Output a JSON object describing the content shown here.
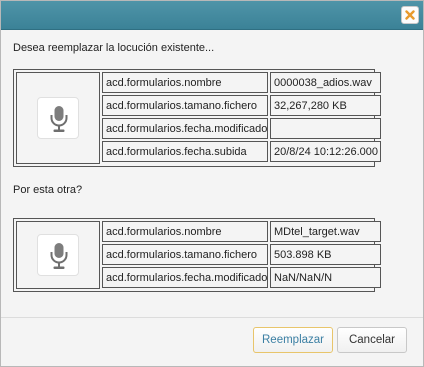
{
  "dialog": {
    "close_icon": "close-x-icon",
    "prompt_existing": "Desea reemplazar la locución existente...",
    "prompt_new": "Por esta otra?",
    "existing": {
      "icon": "microphone-icon",
      "rows": [
        {
          "key": "acd.formularios.nombre",
          "value": "0000038_adios.wav"
        },
        {
          "key": "acd.formularios.tamano.fichero",
          "value": "32,267,280 KB"
        },
        {
          "key": "acd.formularios.fecha.modificado",
          "value": ""
        },
        {
          "key": "acd.formularios.fecha.subida",
          "value": "20/8/24 10:12:26.000"
        }
      ]
    },
    "replacement": {
      "icon": "microphone-icon",
      "rows": [
        {
          "key": "acd.formularios.nombre",
          "value": "MDtel_target.wav"
        },
        {
          "key": "acd.formularios.tamano.fichero",
          "value": "503.898 KB"
        },
        {
          "key": "acd.formularios.fecha.modificado",
          "value": "NaN/NaN/N"
        }
      ]
    },
    "buttons": {
      "replace": "Reemplazar",
      "cancel": "Cancelar"
    },
    "colors": {
      "titlebar": "#4a8fa3",
      "primary_text": "#3b7fa3",
      "primary_border": "#e8c56b",
      "close_x": "#e89a2c"
    }
  }
}
